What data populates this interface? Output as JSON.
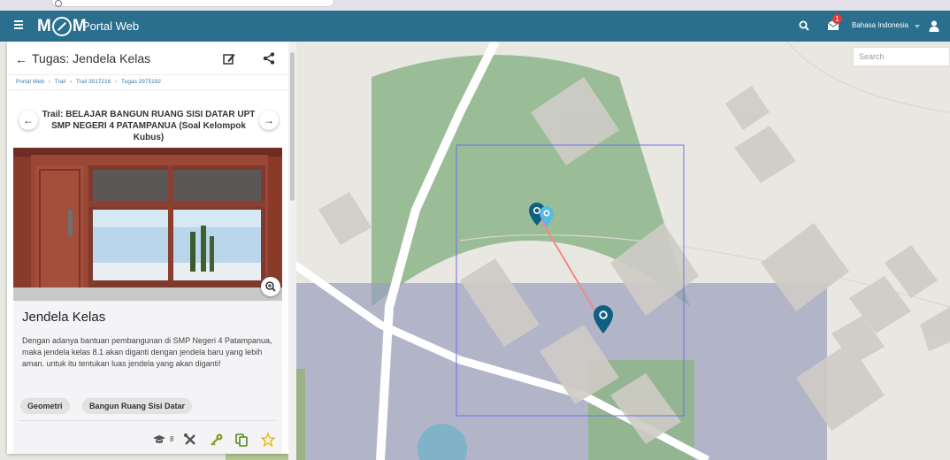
{
  "app": {
    "portal_title": "Portal Web",
    "language": "Bahasa Indonesia",
    "notification_count": "1",
    "brand_color": "#2a6f8e"
  },
  "map": {
    "search_placeholder": "Search"
  },
  "panel": {
    "title": "Tugas: Jendela Kelas",
    "breadcrumb": [
      "Portal Web",
      "Trail 3517216",
      "Tugas 2975192"
    ],
    "trail_title": "Trail: BELAJAR BANGUN RUANG SISI DATAR UPT SMP NEGERI 4 PATAMPANUA (Soal Kelompok Kubus)",
    "task_name": "Jendela Kelas",
    "task_description": "Dengan adanya bantuan pembangunan di SMP Negeri 4 Patampanua, maka jendela kelas 8.1 akan diganti dengan jendela baru yang lebih aman. untuk itu tentukan luas jendela yang akan diganti!",
    "tags": [
      "Geometri",
      "Bangun Ruang Sisi Datar"
    ],
    "grade_count": "8"
  },
  "icons": {
    "menu": "hamburger-icon",
    "search": "search-icon",
    "notification": "notification-icon",
    "user": "user-icon",
    "back": "arrow-left-icon",
    "edit": "edit-icon",
    "share": "share-icon",
    "prev": "arrow-left-icon",
    "next": "arrow-right-icon",
    "zoom": "zoom-icon",
    "grade": "graduation-cap-icon",
    "tools": "tools-icon",
    "key": "key-icon",
    "copy": "copy-icon",
    "star": "star-icon"
  }
}
